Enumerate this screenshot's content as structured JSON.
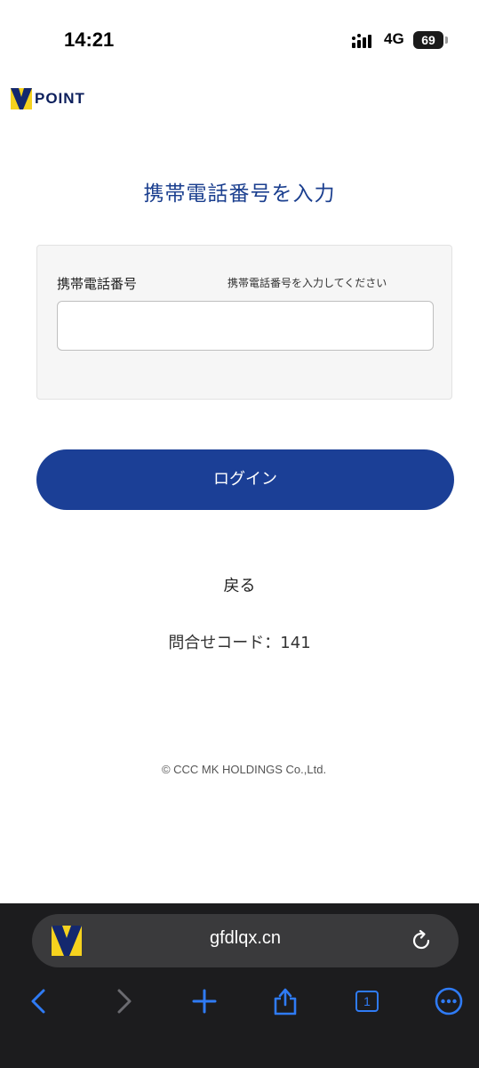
{
  "status_bar": {
    "time": "14:21",
    "network": "4G",
    "battery": "69"
  },
  "brand": {
    "logo_text": "POINT"
  },
  "page": {
    "title": "携帯電話番号を入力",
    "phone_label": "携帯電話番号",
    "phone_hint": "携帯電話番号を入力してください",
    "phone_value": "",
    "login_label": "ログイン",
    "back_label": "戻る",
    "inquiry_code": "問合せコード：141",
    "copyright": "© CCC MK HOLDINGS Co.,Ltd."
  },
  "browser": {
    "url": "gfdlqx.cn",
    "tab_count": "1"
  },
  "colors": {
    "accent": "#1b3f96",
    "title": "#1b3f8f",
    "brand_yellow": "#f6d21e"
  }
}
